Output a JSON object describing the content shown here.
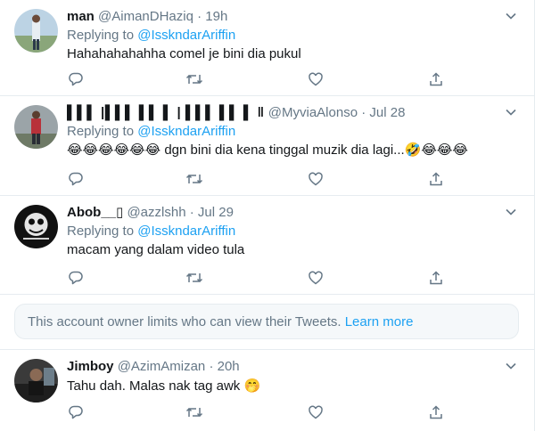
{
  "tweets": [
    {
      "name": "man",
      "handle": "@AimanDHaziq",
      "dot": "·",
      "time": "19h",
      "replying_label": "Replying to",
      "mention": "@IsskndarAriffin",
      "text": "Hahahahahahha comel je bini dia pukul"
    },
    {
      "name": "▌▌▌ |▌▌▌ ▌▌ ▌ | ▌▌▌ ▌▌ ▌ ‖",
      "handle": "@MyviaAlonso",
      "dot": "·",
      "time": "Jul 28",
      "replying_label": "Replying to",
      "mention": "@IsskndarAriffin",
      "text_prefix": "😂😂😂😂😂😂",
      "text_mid": " dgn bini dia kena tinggal muzik dia lagi...",
      "text_suffix": "🤣😂😂😂"
    },
    {
      "name": "Abob__",
      "name_glyph": "▯",
      "handle": "@azzlshh",
      "dot": "·",
      "time": "Jul 29",
      "replying_label": "Replying to",
      "mention": "@IsskndarAriffin",
      "text": "macam yang dalam video tula"
    },
    {
      "name": "Jimboy",
      "handle": "@AzimAmizan",
      "dot": "·",
      "time": "20h",
      "text": "Tahu dah. Malas nak tag awk",
      "text_emoji": "🤭"
    }
  ],
  "notice": {
    "text": "This account owner limits who can view their Tweets.",
    "link": "Learn more"
  },
  "colors": {
    "accent": "#1da1f2",
    "secondary_text": "#657786",
    "border": "#e6ecf0"
  },
  "icons": [
    "reply-icon",
    "retweet-icon",
    "like-icon",
    "share-icon",
    "chevron-down-icon"
  ]
}
